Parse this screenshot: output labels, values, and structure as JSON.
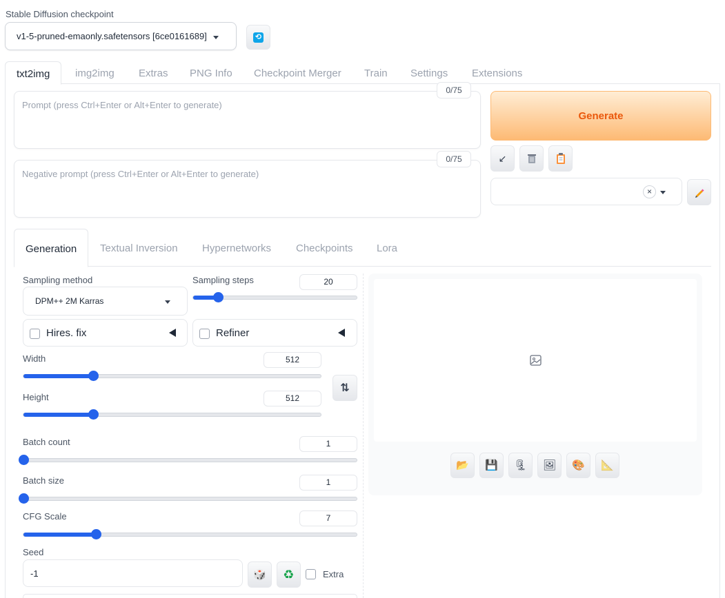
{
  "checkpoint": {
    "label": "Stable Diffusion checkpoint",
    "value": "v1-5-pruned-emaonly.safetensors [6ce0161689]"
  },
  "tabs": [
    "txt2img",
    "img2img",
    "Extras",
    "PNG Info",
    "Checkpoint Merger",
    "Train",
    "Settings",
    "Extensions"
  ],
  "prompt": {
    "placeholder": "Prompt (press Ctrl+Enter or Alt+Enter to generate)",
    "counter": "0/75"
  },
  "negative_prompt": {
    "placeholder": "Negative prompt (press Ctrl+Enter or Alt+Enter to generate)",
    "counter": "0/75"
  },
  "generate_label": "Generate",
  "tools": {
    "read_params_icon": "↙",
    "clear_icon": "trash-icon",
    "paste_icon": "clipboard-icon"
  },
  "style_select": {
    "clear": "×"
  },
  "subtabs": [
    "Generation",
    "Textual Inversion",
    "Hypernetworks",
    "Checkpoints",
    "Lora"
  ],
  "sampling_method": {
    "label": "Sampling method",
    "value": "DPM++ 2M Karras"
  },
  "sampling_steps": {
    "label": "Sampling steps",
    "value": "20",
    "fraction": 0.15
  },
  "hires": {
    "label": "Hires. fix"
  },
  "refiner": {
    "label": "Refiner"
  },
  "width": {
    "label": "Width",
    "value": "512",
    "fraction": 0.235
  },
  "height": {
    "label": "Height",
    "value": "512",
    "fraction": 0.235
  },
  "swap_icon": "⇅",
  "batch_count": {
    "label": "Batch count",
    "value": "1",
    "fraction": 0
  },
  "batch_size": {
    "label": "Batch size",
    "value": "1",
    "fraction": 0
  },
  "cfg_scale": {
    "label": "CFG Scale",
    "value": "7",
    "fraction": 0.218
  },
  "seed": {
    "label": "Seed",
    "value": "-1",
    "dice_icon": "🎲",
    "recycle_icon": "♻",
    "extra_label": "Extra"
  },
  "gallery_tools": [
    "📂",
    "💾",
    "🗜",
    "🖼",
    "🎨",
    "📐"
  ],
  "colors": {
    "accent": "#2563eb",
    "generate_text": "#ea580c"
  }
}
